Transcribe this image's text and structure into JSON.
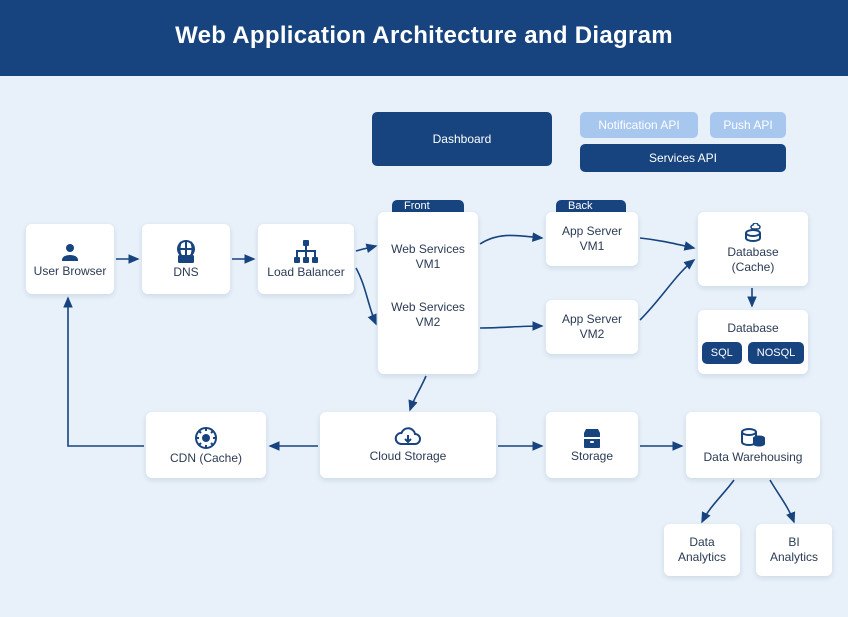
{
  "header": {
    "title": "Web Application Architecture and Diagram"
  },
  "pills": {
    "dashboard": "Dashboard",
    "notification_api": "Notification API",
    "push_api": "Push API",
    "services_api": "Services API",
    "front_end": "Front End",
    "back_end": "Back End"
  },
  "nodes": {
    "user_browser": "User Browser",
    "dns": "DNS",
    "load_balancer": "Load Balancer",
    "web_services_vm1": "Web Services\nVM1",
    "web_services_vm2": "Web Services\nVM2",
    "app_server_vm1": "App Server\nVM1",
    "app_server_vm2": "App Server\nVM2",
    "database_cache": "Database\n(Cache)",
    "database": "Database",
    "sql": "SQL",
    "nosql": "NOSQL",
    "cdn_cache": "CDN (Cache)",
    "cloud_storage": "Cloud Storage",
    "storage": "Storage",
    "data_warehousing": "Data Warehousing",
    "data_analytics": "Data\nAnalytics",
    "bi_analytics": "BI\nAnalytics"
  },
  "colors": {
    "primary": "#17447e",
    "bg": "#e8f1fa",
    "light_pill": "#a7c7ef"
  }
}
